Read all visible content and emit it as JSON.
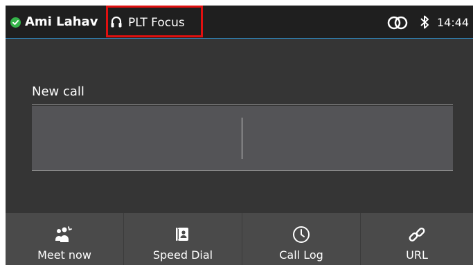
{
  "status_bar": {
    "user_name": "Ami Lahav",
    "presence_color": "#35b44a",
    "headset_icon": "headset-icon",
    "headset_label": "PLT Focus",
    "highlight_color": "#e01010",
    "rings_icon": "linked-rings-icon",
    "bluetooth_icon": "bluetooth-icon",
    "time": "14:44"
  },
  "main": {
    "new_call_label": "New call",
    "dial_input_value": ""
  },
  "softkeys": [
    {
      "label": "Meet now",
      "icon": "meet-now-icon"
    },
    {
      "label": "Speed Dial",
      "icon": "speed-dial-icon"
    },
    {
      "label": "Call Log",
      "icon": "clock-icon"
    },
    {
      "label": "URL",
      "icon": "link-icon"
    }
  ]
}
